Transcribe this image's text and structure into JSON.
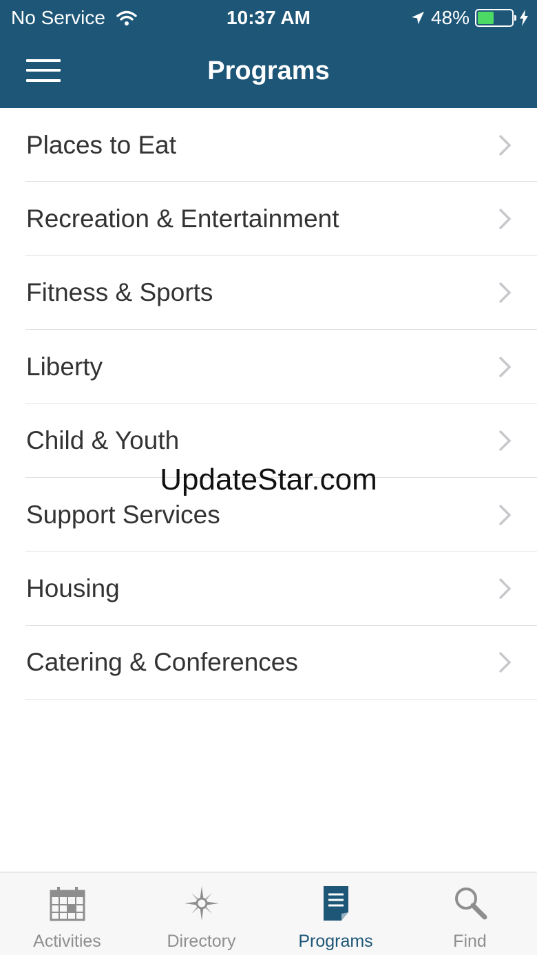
{
  "status_bar": {
    "carrier": "No Service",
    "time": "10:37 AM",
    "battery_percent": "48%",
    "battery_level": 0.48,
    "battery_color": "#4cd964"
  },
  "header": {
    "title": "Programs",
    "menu_icon": "hamburger-icon",
    "background": "#1d5677"
  },
  "list": {
    "items": [
      {
        "label": "Places to Eat"
      },
      {
        "label": "Recreation & Entertainment"
      },
      {
        "label": "Fitness & Sports"
      },
      {
        "label": "Liberty"
      },
      {
        "label": "Child & Youth"
      },
      {
        "label": "Support Services"
      },
      {
        "label": "Housing"
      },
      {
        "label": "Catering & Conferences"
      }
    ]
  },
  "watermark": "UpdateStar.com",
  "tab_bar": {
    "tabs": [
      {
        "label": "Activities",
        "icon": "calendar-icon"
      },
      {
        "label": "Directory",
        "icon": "compass-icon"
      },
      {
        "label": "Programs",
        "icon": "document-icon",
        "active": true
      },
      {
        "label": "Find",
        "icon": "search-icon"
      }
    ],
    "active_color": "#1d5677",
    "inactive_color": "#8e8e8e"
  }
}
